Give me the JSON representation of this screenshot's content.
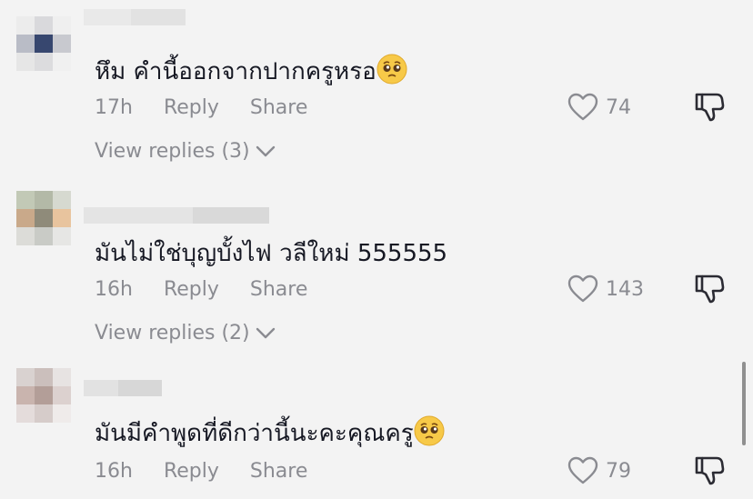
{
  "comments": [
    {
      "text": "หึม คำนี้ออกจากปากครูหรอ",
      "has_emoji": true,
      "time": "17h",
      "reply_label": "Reply",
      "share_label": "Share",
      "likes": "74",
      "replies_label": "View replies (3)"
    },
    {
      "text": "มันไม่ใช่บุญบั้งไฟ วลีใหม่ 555555",
      "has_emoji": false,
      "time": "16h",
      "reply_label": "Reply",
      "share_label": "Share",
      "likes": "143",
      "replies_label": "View replies (2)"
    },
    {
      "text": "มันมีคำพูดที่ดีกว่านี้นะคะคุณครู",
      "has_emoji": true,
      "time": "16h",
      "reply_label": "Reply",
      "share_label": "Share",
      "likes": "79",
      "replies_label": ""
    }
  ],
  "icons": {
    "like": "heart-outline-icon",
    "dislike": "thumbs-down-icon",
    "chevron": "chevron-down-icon",
    "emoji": "pleading-face-emoji"
  },
  "colors": {
    "background": "#f3f3f3",
    "text": "#161823",
    "secondary": "#8a8b91"
  }
}
